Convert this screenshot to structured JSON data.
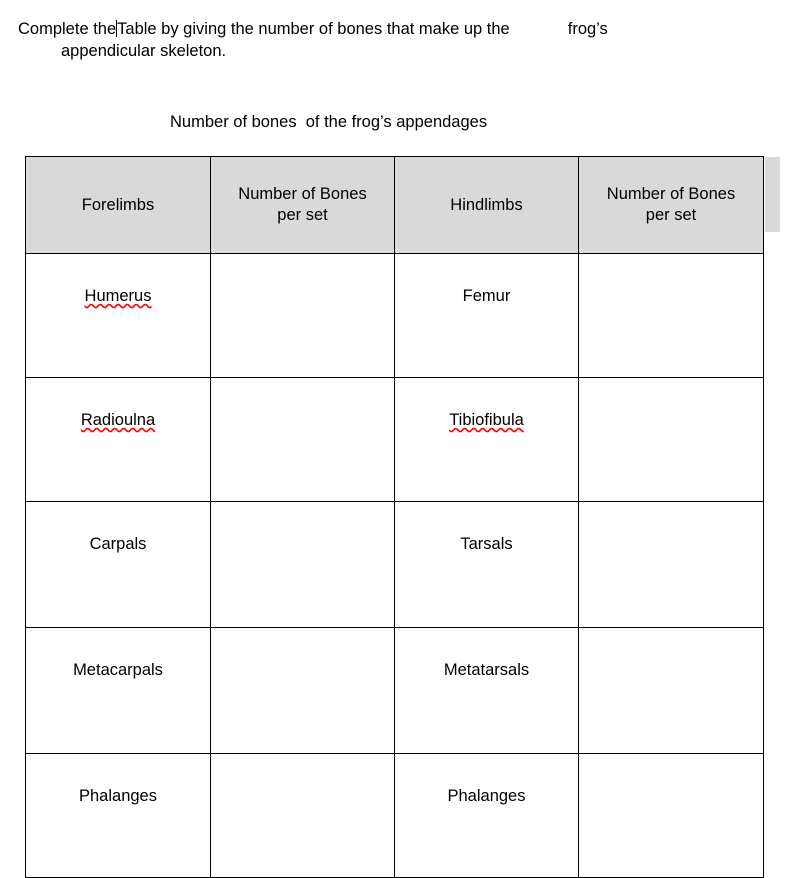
{
  "document": {
    "instruction": {
      "line1_part1": "Complete the",
      "line1_part2": "Table by giving the number of bones that make up the",
      "line1_part3": "frog’s",
      "line2": "appendicular skeleton."
    },
    "table_caption": "Number of bones  of the frog’s appendages"
  },
  "table": {
    "headers": [
      "Forelimbs",
      "Number of Bones per set",
      "Hindlimbs",
      "Number of Bones per set"
    ],
    "headers_lines": [
      [
        "Forelimbs"
      ],
      [
        "Number of Bones",
        "per set"
      ],
      [
        "Hindlimbs"
      ],
      [
        "Number of Bones",
        "per set"
      ]
    ],
    "rows": [
      {
        "forelimb": "Humerus",
        "forelimb_misspelled": true,
        "forelimb_count": "",
        "hindlimb": "Femur",
        "hindlimb_misspelled": false,
        "hindlimb_count": ""
      },
      {
        "forelimb": "Radioulna",
        "forelimb_misspelled": true,
        "forelimb_count": "",
        "hindlimb": "Tibiofibula",
        "hindlimb_misspelled": true,
        "hindlimb_count": ""
      },
      {
        "forelimb": "Carpals",
        "forelimb_misspelled": false,
        "forelimb_count": "",
        "hindlimb": "Tarsals",
        "hindlimb_misspelled": false,
        "hindlimb_count": ""
      },
      {
        "forelimb": "Metacarpals",
        "forelimb_misspelled": false,
        "forelimb_count": "",
        "hindlimb": "Metatarsals",
        "hindlimb_misspelled": false,
        "hindlimb_count": ""
      },
      {
        "forelimb": "Phalanges",
        "forelimb_misspelled": false,
        "forelimb_count": "",
        "hindlimb": "Phalanges",
        "hindlimb_misspelled": false,
        "hindlimb_count": ""
      }
    ]
  },
  "style": {
    "header_fill": "#d9d9d9",
    "border_color": "#000000",
    "text_color": "#000000",
    "spellcheck_underline_color": "#ff0000",
    "page_background": "#ffffff"
  }
}
